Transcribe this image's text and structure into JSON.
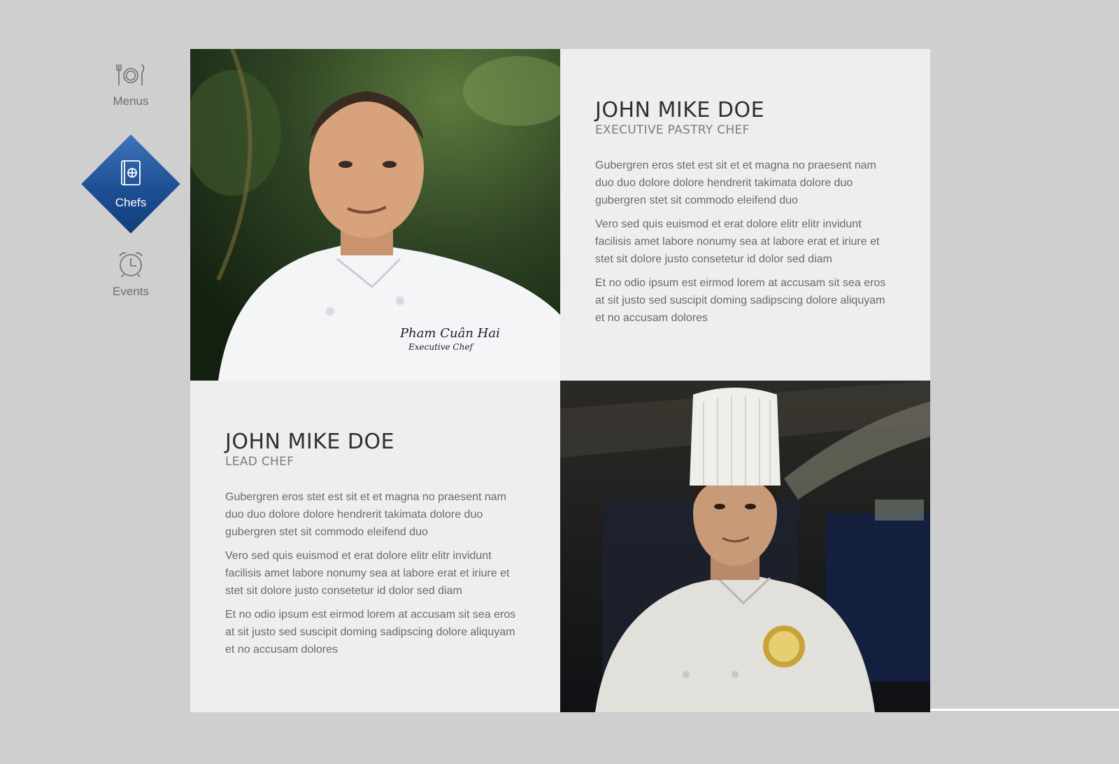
{
  "nav": {
    "items": [
      {
        "label": "Menus",
        "icon": "plate-cutlery-icon",
        "active": false
      },
      {
        "label": "Chefs",
        "icon": "chef-book-icon",
        "active": true
      },
      {
        "label": "Events",
        "icon": "alarm-clock-icon",
        "active": false
      }
    ],
    "active_color": "#1d4f93"
  },
  "chefs": [
    {
      "name": "JOHN MIKE DOE",
      "title": "EXECUTIVE PASTRY CHEF",
      "paragraphs": [
        "Gubergren eros stet est sit et et magna no praesent nam duo duo dolore dolore hendrerit takimata dolore duo gubergren stet sit commodo eleifend duo",
        "Vero sed quis euismod et erat dolore elitr elitr invidunt facilisis amet labore nonumy sea at labore erat et iriure et stet sit dolore justo consetetur id dolor sed diam",
        "Et no odio ipsum est eirmod lorem at accusam sit sea eros at sit justo sed suscipit doming sadipscing dolore aliquyam et no accusam dolores"
      ],
      "photo": {
        "embroidery_line1": "Pham Cuân Hai",
        "embroidery_line2": "Executive Chef"
      }
    },
    {
      "name": "JOHN MIKE DOE",
      "title": "LEAD CHEF",
      "paragraphs": [
        "Gubergren eros stet est sit et et magna no praesent nam duo duo dolore dolore hendrerit takimata dolore duo gubergren stet sit commodo eleifend duo",
        "Vero sed quis euismod et erat dolore elitr elitr invidunt facilisis amet labore nonumy sea at labore erat et iriure et stet sit dolore justo consetetur id dolor sed diam",
        "Et no odio ipsum est eirmod lorem at accusam sit sea eros at sit justo sed suscipit doming sadipscing dolore aliquyam et no accusam dolores"
      ]
    }
  ]
}
